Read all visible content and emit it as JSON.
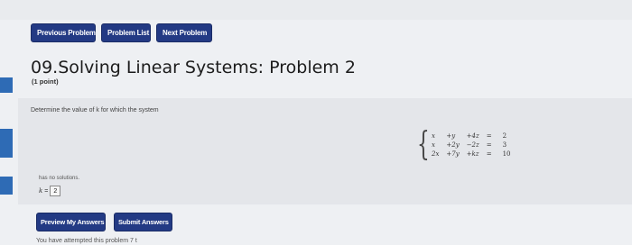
{
  "nav": {
    "previous_label": "Previous Problem",
    "list_label": "Problem List",
    "next_label": "Next Problem"
  },
  "problem": {
    "title": "09.Solving Linear Systems: Problem 2",
    "points": "(1 point)",
    "prompt": "Determine the value of k for which the system",
    "equations": [
      [
        "x",
        "+y",
        "+4z",
        "=",
        "2"
      ],
      [
        "x",
        "+2y",
        "−2z",
        "=",
        "3"
      ],
      [
        "2x",
        "+7y",
        "+kz",
        "=",
        "10"
      ]
    ],
    "no_solutions_text": "has no solutions.",
    "answer_variable": "k",
    "answer_equals": "=",
    "answer_value": "2"
  },
  "actions": {
    "preview_label": "Preview My Answers",
    "submit_label": "Submit Answers"
  },
  "footer": {
    "text": "You have attempted this problem 7 t"
  },
  "colors": {
    "button_bg": "#233a84",
    "side_tab": "#2e6bb5",
    "page_bg": "#eef0f3",
    "problem_bg": "#e4e6ea"
  }
}
